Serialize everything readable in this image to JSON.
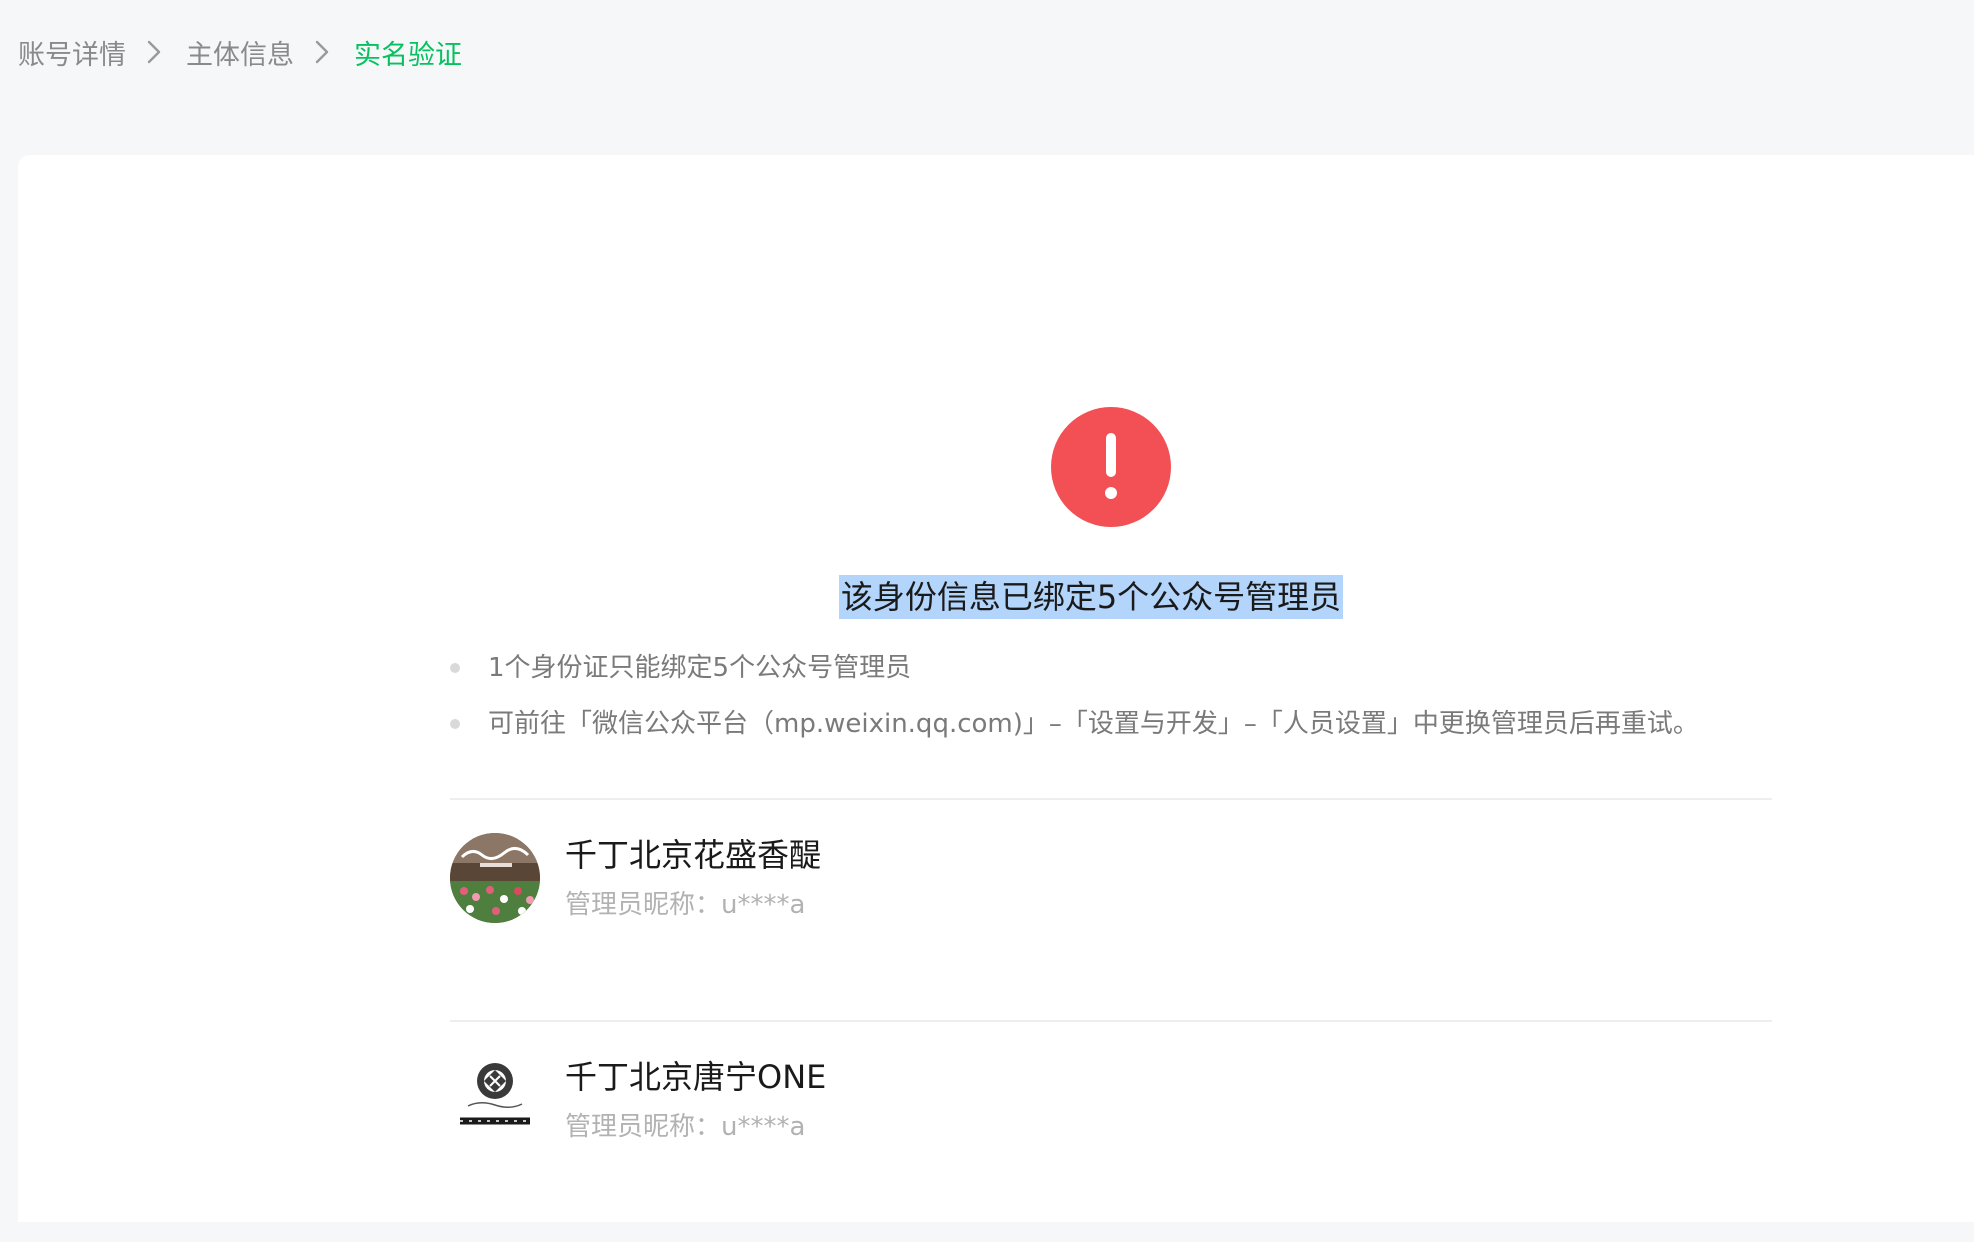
{
  "breadcrumb": {
    "items": [
      "账号详情",
      "主体信息"
    ],
    "current": "实名验证"
  },
  "status": {
    "icon": "exclamation-icon",
    "color": "#f25054",
    "headline": "该身份信息已绑定5个公众号管理员"
  },
  "tips": [
    "1个身份证只能绑定5个公众号管理员",
    "可前往「微信公众平台（mp.weixin.qq.com)」–「设置与开发」–「人员设置」中更换管理员后再重试。"
  ],
  "accounts": [
    {
      "name": "千丁北京花盛香醍",
      "nickname": "管理员昵称：u****a",
      "avatar": "photo-avatar"
    },
    {
      "name": "千丁北京唐宁ONE",
      "nickname": "管理员昵称：u****a",
      "avatar": "logo-avatar"
    }
  ],
  "colors": {
    "accent": "#07c160",
    "selection": "#b3d4fb"
  }
}
